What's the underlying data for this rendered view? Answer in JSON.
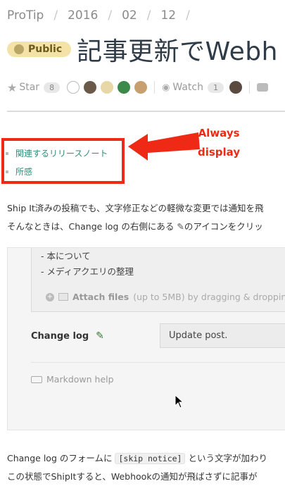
{
  "breadcrumb": [
    "ProTip",
    "2016",
    "02",
    "12"
  ],
  "badge": {
    "label": "Public"
  },
  "title": "記事更新でWebh",
  "meta": {
    "star_label": "Star",
    "star_count": "8",
    "watch_label": "Watch",
    "watch_count": "1"
  },
  "toc": [
    "関連するリリースノート",
    "所感"
  ],
  "annotation": {
    "line1": "Always",
    "line2": "display"
  },
  "body": {
    "line1": "Ship It済みの投稿でも、文字修正などの軽微な変更では通知を飛",
    "line2_before": "そんなときは、Change log の右側にある ",
    "line2_after": "のアイコンをクリッ"
  },
  "editor": {
    "line1": "- 本について",
    "line2": "- メディアクエリの整理",
    "attach_label": "Attach files",
    "attach_hint": "(up to 5MB) by dragging & dropping"
  },
  "changelog": {
    "label": "Change log",
    "value": "Update post."
  },
  "markdown_help": "Markdown help",
  "footer": {
    "line1_before": "Change log のフォームに ",
    "code": "[skip notice]",
    "line1_after": " という文字が加わり",
    "line2": "この状態でShipItすると、Webhookの通知が飛ばさずに記事が"
  },
  "colors": {
    "accent": "#2d8d7a",
    "annotation": "#ee2a16",
    "badge_bg": "#f3e3a6"
  }
}
